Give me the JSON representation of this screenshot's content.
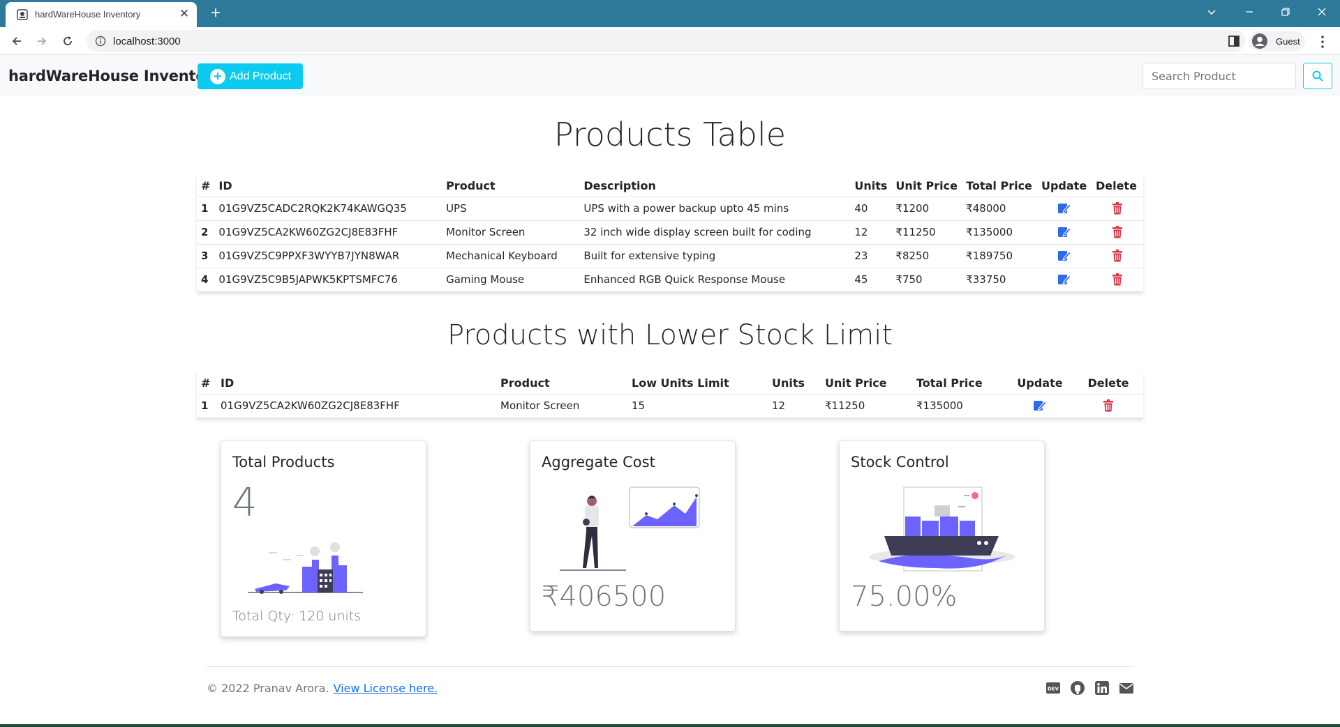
{
  "browser": {
    "tab_title": "hardWareHouse Inventory",
    "url": "localhost:3000",
    "profile_name": "Guest"
  },
  "navbar": {
    "brand": "hardWareHouse Inventory",
    "add_product_label": "Add Product",
    "search_placeholder": "Search Product"
  },
  "products_section": {
    "title": "Products Table",
    "headers": [
      "#",
      "ID",
      "Product",
      "Description",
      "Units",
      "Unit Price",
      "Total Price",
      "Update",
      "Delete"
    ],
    "rows": [
      {
        "num": "1",
        "id": "01G9VZ5CADC2RQK2K74KAWGQ35",
        "product": "UPS",
        "description": "UPS with a power backup upto 45 mins",
        "units": "40",
        "unit_price": "₹1200",
        "total_price": "₹48000"
      },
      {
        "num": "2",
        "id": "01G9VZ5CA2KW60ZG2CJ8E83FHF",
        "product": "Monitor Screen",
        "description": "32 inch wide display screen built for coding",
        "units": "12",
        "unit_price": "₹11250",
        "total_price": "₹135000"
      },
      {
        "num": "3",
        "id": "01G9VZ5C9PPXF3WYYB7JYN8WAR",
        "product": "Mechanical Keyboard",
        "description": "Built for extensive typing",
        "units": "23",
        "unit_price": "₹8250",
        "total_price": "₹189750"
      },
      {
        "num": "4",
        "id": "01G9VZ5C9B5JAPWK5KPTSMFC76",
        "product": "Gaming Mouse",
        "description": "Enhanced RGB Quick Response Mouse",
        "units": "45",
        "unit_price": "₹750",
        "total_price": "₹33750"
      }
    ]
  },
  "lowstock_section": {
    "title": "Products with Lower Stock Limit",
    "headers": [
      "#",
      "ID",
      "Product",
      "Low Units Limit",
      "Units",
      "Unit Price",
      "Total Price",
      "Update",
      "Delete"
    ],
    "rows": [
      {
        "num": "1",
        "id": "01G9VZ5CA2KW60ZG2CJ8E83FHF",
        "product": "Monitor Screen",
        "low_limit": "15",
        "units": "12",
        "unit_price": "₹11250",
        "total_price": "₹135000"
      }
    ]
  },
  "cards": {
    "total_products": {
      "title": "Total Products",
      "value": "4",
      "sub": "Total Qty: 120 units"
    },
    "aggregate_cost": {
      "title": "Aggregate Cost",
      "value": "₹406500"
    },
    "stock_control": {
      "title": "Stock Control",
      "value": "75.00%"
    }
  },
  "footer": {
    "copyright": "© 2022 Pranav Arora.",
    "license_link": "View License here."
  },
  "colors": {
    "accent": "#0dcaf0",
    "edit_icon": "#2c6bed",
    "delete_icon": "#dc3545",
    "illustration": "#6c63ff"
  },
  "icons": {
    "update": "pencil-square-icon",
    "delete": "trash-icon",
    "social": [
      "dev-icon",
      "github-icon",
      "linkedin-icon",
      "envelope-icon"
    ]
  }
}
